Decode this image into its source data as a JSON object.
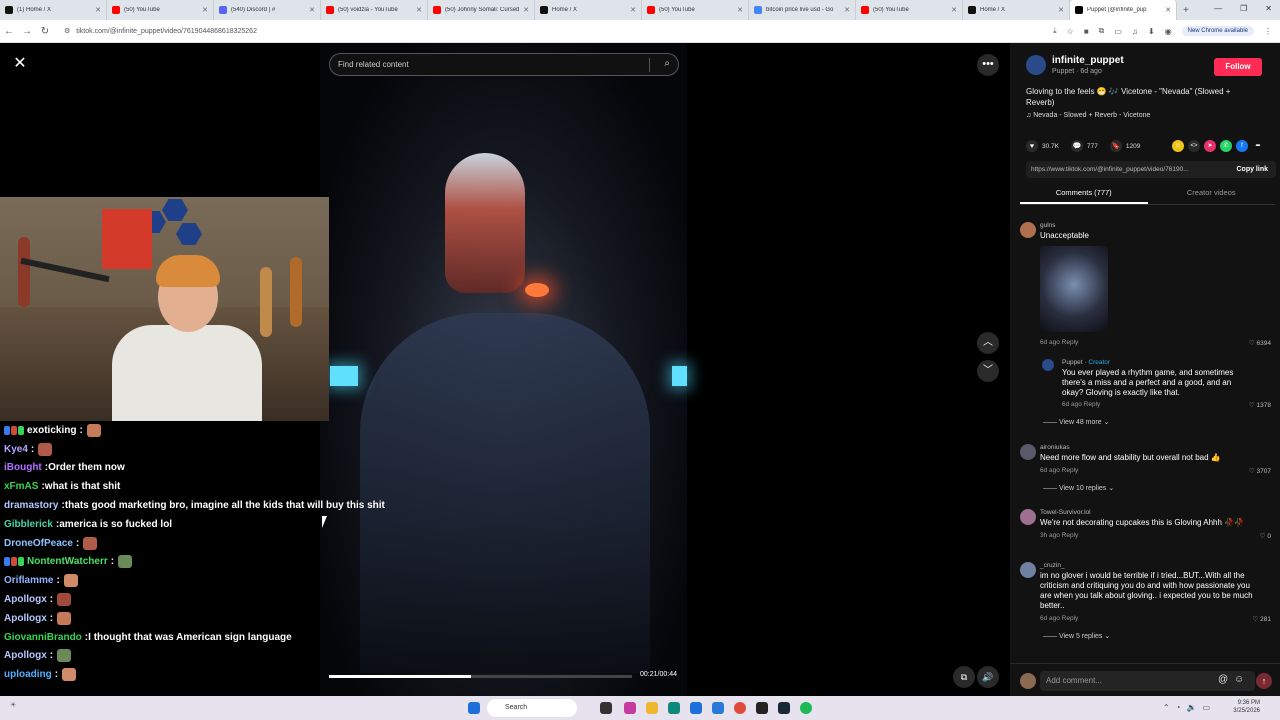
{
  "browser": {
    "tabs": [
      {
        "title": "(1) Home / X",
        "fav": "#111111"
      },
      {
        "title": "(50) YouTube",
        "fav": "#ff0000"
      },
      {
        "title": "(540) Discord | #",
        "fav": "#5865f2"
      },
      {
        "title": "(50) voidzla - YouTube",
        "fav": "#ff0000"
      },
      {
        "title": "(50) Johnny Somali: Cursed",
        "fav": "#ff0000"
      },
      {
        "title": "Home / X",
        "fav": "#111111"
      },
      {
        "title": "(50) YouTube",
        "fav": "#ff0000"
      },
      {
        "title": "bitcoin price live usd - Go",
        "fav": "#4285f4"
      },
      {
        "title": "(50) YouTube",
        "fav": "#ff0000"
      },
      {
        "title": "Home / X",
        "fav": "#111111"
      },
      {
        "title": "Puppet (@infinite_pup",
        "fav": "#000000"
      }
    ],
    "url": "tiktok.com/@infinite_puppet/video/7619044868618325262",
    "new_chrome": "New Chrome available"
  },
  "video": {
    "search_placeholder": "Find related content",
    "time": "00:21/00:44",
    "progress": 0.47
  },
  "author": {
    "name": "infinite_puppet",
    "sub": "Puppet · 6d ago",
    "follow": "Follow",
    "description": "Gloving to the feels 😁 🎶 Vicetone - \"Nevada\" (Slowed + Reverb)",
    "music": "Nevada - Slowed + Reverb - Vicetone"
  },
  "stats": {
    "likes": "30.7K",
    "comments": "777",
    "saves": "1209"
  },
  "link": {
    "url": "https://www.tiktok.com/@infinite_puppet/video/76190...",
    "copy": "Copy link"
  },
  "panel_tabs": {
    "comments": "Comments (777)",
    "creator": "Creator videos"
  },
  "comments": [
    {
      "user": "gulns",
      "text": "Unacceptable",
      "meta": "6d ago   Reply",
      "likes": "6394",
      "color": "#b07050"
    },
    {
      "user": "Puppet · ",
      "creator": "Creator",
      "text": "You ever played a rhythm game, and sometimes there's a miss and a perfect and a good, and an okay? Gloving is exactly like that.",
      "meta": "6d ago   Reply",
      "likes": "1378",
      "color": "#2a4a8a"
    },
    {
      "user": "aironiukas",
      "text": "Need more flow and stability but overall not bad 👍",
      "meta": "6d ago   Reply",
      "likes": "3707",
      "color": "#5a5a6a"
    },
    {
      "user": "Towel-Survivor.lol",
      "text": "We're not decorating cupcakes this is Gloving Ahhh 🥀🥀",
      "meta": "3h ago   Reply",
      "likes": "0",
      "color": "#a07090"
    },
    {
      "user": "_cruzin_",
      "text": "im no glover i would be terrible if i tried...BUT...With all the criticism and critiquing you do and with how passionate you are when you talk about gloving.. i expected you to be much better..",
      "meta": "6d ago   Reply",
      "likes": "281",
      "color": "#7080a0"
    }
  ],
  "view_more": {
    "first": "View 48 more",
    "second": "View 10 replies",
    "third": "View 5 replies"
  },
  "add_comment": "Add comment...",
  "chat": [
    {
      "name": "exoticking",
      "msg": "",
      "color": "#ffffff"
    },
    {
      "name": "Kye4",
      "msg": "",
      "color": "#b0a8ff"
    },
    {
      "name": "iBought",
      "msg": "Order them now",
      "color": "#b070ff"
    },
    {
      "name": "xFmAS",
      "msg": "what is that shit",
      "color": "#39d353"
    },
    {
      "name": "dramastory",
      "msg": "thats good marketing bro, imagine all the kids that will buy this shit",
      "color": "#b6c7ff"
    },
    {
      "name": "Gibblerick",
      "msg": "america is so fucked lol",
      "color": "#46d3a8"
    },
    {
      "name": "DroneOfPeace",
      "msg": "",
      "color": "#8ec3ff"
    },
    {
      "name": "NontentWatcherr",
      "msg": "",
      "color": "#4ce06a"
    },
    {
      "name": "Oriflamme",
      "msg": "",
      "color": "#8fb4ff"
    },
    {
      "name": "Apollogx",
      "msg": "",
      "color": "#b6c7ff"
    },
    {
      "name": "Apollogx",
      "msg": "",
      "color": "#b6c7ff"
    },
    {
      "name": "GiovanniBrando",
      "msg": "I thought that was American sign language",
      "color": "#39d353"
    },
    {
      "name": "Apollogx",
      "msg": "",
      "color": "#b6c7ff"
    },
    {
      "name": "uploading",
      "msg": "",
      "color": "#4fb0ff"
    }
  ],
  "taskbar": {
    "search": "Search",
    "time": "9:36 PM",
    "date": "3/25/2026"
  }
}
